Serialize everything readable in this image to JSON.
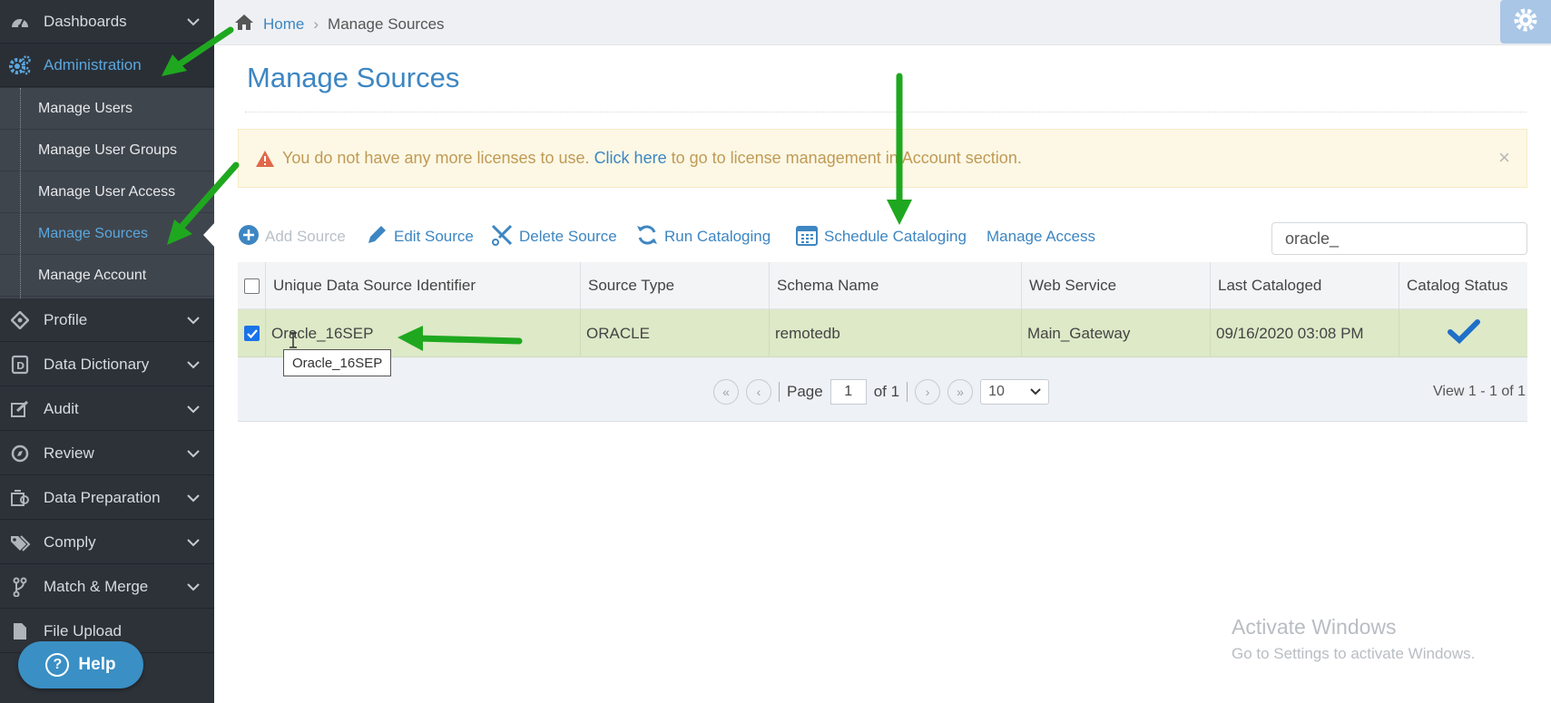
{
  "sidebar": {
    "items": [
      {
        "label": "Dashboards",
        "icon": "dashboard-icon"
      },
      {
        "label": "Administration",
        "icon": "cogs-icon"
      },
      {
        "label": "Profile",
        "icon": "profile-icon"
      },
      {
        "label": "Data Dictionary",
        "icon": "data-dictionary-icon"
      },
      {
        "label": "Audit",
        "icon": "audit-icon"
      },
      {
        "label": "Review",
        "icon": "review-icon"
      },
      {
        "label": "Data Preparation",
        "icon": "data-preparation-icon"
      },
      {
        "label": "Comply",
        "icon": "tags-icon"
      },
      {
        "label": "Match & Merge",
        "icon": "merge-icon"
      },
      {
        "label": "File Upload",
        "icon": "file-icon"
      }
    ],
    "submenu": [
      {
        "label": "Manage Users"
      },
      {
        "label": "Manage User Groups"
      },
      {
        "label": "Manage User Access"
      },
      {
        "label": "Manage Sources"
      },
      {
        "label": "Manage Account"
      }
    ],
    "help_label": "Help"
  },
  "breadcrumb": {
    "home": "Home",
    "current": "Manage Sources"
  },
  "page": {
    "title": "Manage Sources"
  },
  "alert": {
    "text_before": "You do not have any more licenses to use.",
    "link": "Click here",
    "text_after": "to go to license management in Account section."
  },
  "toolbar": {
    "add_source": "Add Source",
    "edit_source": "Edit Source",
    "delete_source": "Delete Source",
    "run_cataloging": "Run Cataloging",
    "schedule_cataloging": "Schedule Cataloging",
    "manage_access": "Manage Access"
  },
  "search": {
    "value": "oracle_"
  },
  "table": {
    "columns": [
      "Unique Data Source Identifier",
      "Source Type",
      "Schema Name",
      "Web Service",
      "Last Cataloged",
      "Catalog Status"
    ],
    "rows": [
      {
        "identifier": "Oracle_16SEP",
        "source_type": "ORACLE",
        "schema": "remotedb",
        "web_service": "Main_Gateway",
        "last_cataloged": "09/16/2020 03:08 PM",
        "status_icon": "checkmark-icon",
        "selected": true
      }
    ],
    "tooltip": "Oracle_16SEP"
  },
  "pager": {
    "page_label": "Page",
    "page": "1",
    "of_label": "of 1",
    "page_size": "10",
    "view_info": "View 1 - 1 of 1"
  },
  "watermark": {
    "line1": "Activate Windows",
    "line2": "Go to Settings to activate Windows."
  },
  "colors": {
    "accent": "#3d86c2",
    "sidebar": "#2d3239",
    "selected_row": "#dde9c7",
    "arrow": "#1fa81f"
  }
}
